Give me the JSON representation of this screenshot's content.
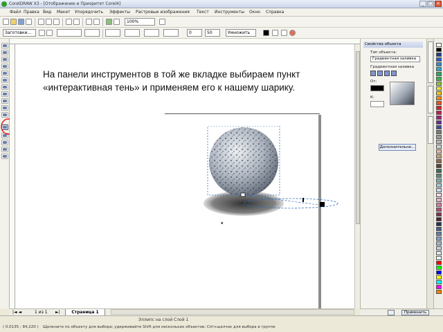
{
  "window": {
    "title": "CorelDRAW X3 - [Отображение и Приоритет Corel4]",
    "controls": [
      "_",
      "□",
      "×"
    ]
  },
  "menu": {
    "items": [
      "Файл",
      "Правка",
      "Вид",
      "Макет",
      "Упорядочить",
      "Эффекты",
      "Растровые изображения",
      "Текст",
      "Инструменты",
      "Окно",
      "Справка"
    ]
  },
  "toolbar": {
    "zoom": "100%",
    "preset": "Заготовки...",
    "opacity_a": "0",
    "opacity_b": "50",
    "mode": "Умножить"
  },
  "canvas": {
    "instruction": "На панели инструментов в той же вкладке выбираем пункт «интерактивная тень» и применяем его к нашему шарику.",
    "ellipse_fill": "#a7b0c4"
  },
  "docker": {
    "title": "Свойства объекта",
    "tabs_label": "Тип объекта:",
    "object_type": "Градиентная заливка",
    "fill_label": "Градиентная заливка",
    "from_label": "От:",
    "to_label": "К:",
    "apply_label": "Дополнительно...",
    "lock_label": "Применить"
  },
  "pagebar": {
    "pages": "1 из 1",
    "tab": "Страница 1"
  },
  "status": {
    "line1": "Эллипс на слой Слой 1",
    "coords": "( 0,0135 ; 84,220 )",
    "hint": "Щелкните по объекту для выбора; удерживайте Shift для нескольких объектов; Ctrl+щелчок для выбора в группе"
  },
  "colors": {
    "accent": "#2f5fa8",
    "highlight_ring": "#e0201a"
  },
  "palette": [
    "#ffffff",
    "#000000",
    "#1f3a8a",
    "#3358c9",
    "#3b86c7",
    "#2ea7c8",
    "#2aa65a",
    "#37b34a",
    "#8fc340",
    "#e8e43a",
    "#f5c21a",
    "#f08a1a",
    "#e8531c",
    "#d72020",
    "#c21a48",
    "#a01f7c",
    "#6a2b8c",
    "#454b9a",
    "#7a7a7a",
    "#9a9a9a",
    "#b6b6b6",
    "#d0d0d0",
    "#e6b8a0",
    "#c8a07a",
    "#8c6a4a",
    "#5a4030",
    "#3a6a5a",
    "#5a8a7a",
    "#7ab0b0",
    "#a0c8d8",
    "#c8dff0",
    "#f0d8e8",
    "#e8b0c8",
    "#d080a0",
    "#b05070",
    "#803050",
    "#502030",
    "#203050",
    "#406080",
    "#6080a0",
    "#80a0c0",
    "#a0b8d0",
    "#c0d0e0",
    "#e0e8f0",
    "#f0f0f0",
    "#ff0000",
    "#00ff00",
    "#0000ff",
    "#ffff00",
    "#00ffff",
    "#ff00ff",
    "#ff8000"
  ]
}
